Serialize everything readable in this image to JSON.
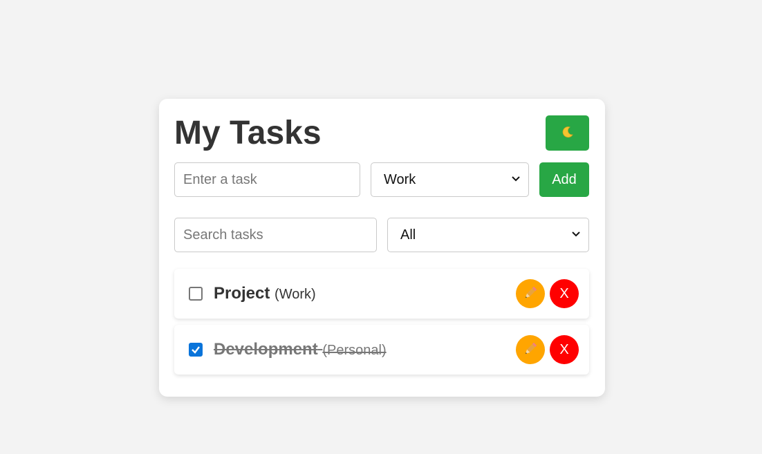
{
  "header": {
    "title": "My Tasks",
    "theme_toggle_icon": "moon-icon"
  },
  "new_task": {
    "input_placeholder": "Enter a task",
    "category_selected": "Work",
    "add_label": "Add"
  },
  "filters": {
    "search_placeholder": "Search tasks",
    "filter_selected": "All"
  },
  "tasks": [
    {
      "name": "Project",
      "category": "(Work)",
      "completed": false,
      "edit_icon": "pencil-icon",
      "delete_label": "X"
    },
    {
      "name": "Development",
      "category": "(Personal)",
      "completed": true,
      "edit_icon": "pencil-icon",
      "delete_label": "X"
    }
  ],
  "colors": {
    "accent_green": "#28a745",
    "edit_orange": "#ffa500",
    "delete_red": "#ff0000",
    "checkbox_blue": "#0a74da"
  }
}
